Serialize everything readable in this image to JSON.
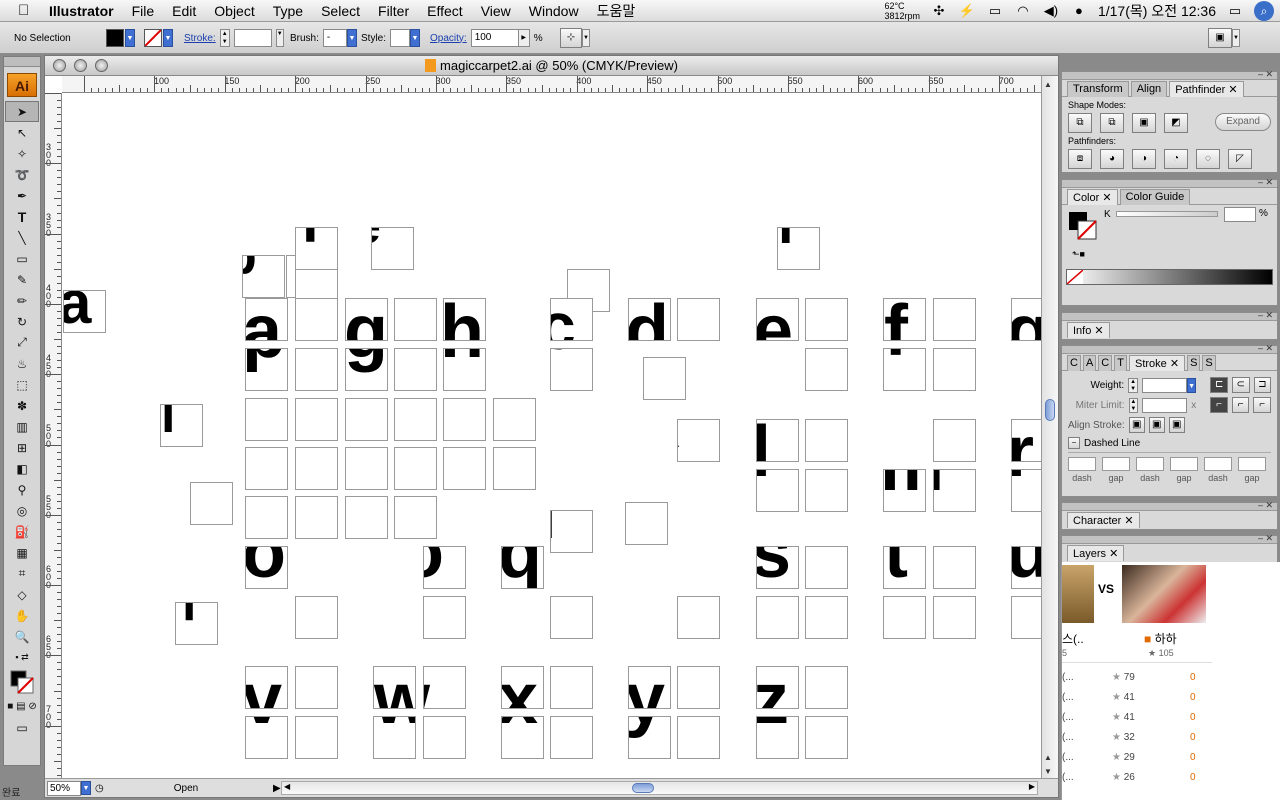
{
  "menubar": {
    "items": [
      "Illustrator",
      "File",
      "Edit",
      "Object",
      "Type",
      "Select",
      "Filter",
      "Effect",
      "View",
      "Window",
      "도움말"
    ],
    "temp": "62°C",
    "rpm": "3812rpm",
    "datetime": "1/17(목) 오전 12:36"
  },
  "controlbar": {
    "selection": "No Selection",
    "stroke_label": "Stroke:",
    "brush_label": "Brush:",
    "brush_value": "-",
    "style_label": "Style:",
    "opacity_label": "Opacity:",
    "opacity_value": "100",
    "percent": "%"
  },
  "tools": {
    "logo": "Ai"
  },
  "document": {
    "title": "magiccarpet2.ai @ 50% (CMYK/Preview)",
    "ruler_h": [
      "100",
      "150",
      "200",
      "250",
      "300",
      "350",
      "400",
      "450",
      "500",
      "550",
      "600",
      "650",
      "700"
    ],
    "ruler_v": [
      "300",
      "350",
      "400",
      "450",
      "500",
      "550",
      "600",
      "650",
      "700"
    ],
    "zoom": "50%",
    "status": "Open"
  },
  "panels": {
    "pathfinder": {
      "tabs": [
        "Transform",
        "Align",
        "Pathfinder"
      ],
      "shape_modes": "Shape Modes:",
      "pathfinders": "Pathfinders:",
      "expand": "Expand"
    },
    "color": {
      "tabs": [
        "Color",
        "Color Guide"
      ],
      "channel": "K",
      "percent": "%"
    },
    "info": {
      "tabs": [
        "Info"
      ]
    },
    "stroke": {
      "tabs": [
        "C",
        "A",
        "C",
        "T",
        "Stroke",
        "S",
        "S"
      ],
      "weight_label": "Weight:",
      "miter_label": "Miter Limit:",
      "miter_unit": "x",
      "align_label": "Align Stroke:",
      "dashed_label": "Dashed Line",
      "dash_labels": [
        "dash",
        "gap",
        "dash",
        "gap",
        "dash",
        "gap"
      ]
    },
    "character": {
      "tabs": [
        "Character"
      ]
    },
    "layers": {
      "tabs": [
        "Layers"
      ]
    }
  },
  "webpeek": {
    "vs": "VS",
    "left_text": "스(..",
    "left_num": "5",
    "badge": "하하",
    "count": "105",
    "rows": [
      {
        "label": "(...",
        "stars": "79",
        "val": "0"
      },
      {
        "label": "(...",
        "stars": "41",
        "val": "0"
      },
      {
        "label": "(...",
        "stars": "41",
        "val": "0"
      },
      {
        "label": "(...",
        "stars": "32",
        "val": "0"
      },
      {
        "label": "(...",
        "stars": "29",
        "val": "0"
      },
      {
        "label": "(...",
        "stars": "26",
        "val": "0"
      }
    ]
  },
  "dock": {
    "left_label": "완료"
  },
  "canvas_letters": [
    "a",
    "b",
    "c",
    "d",
    "e",
    "f",
    "g",
    "h",
    "i",
    "j",
    "k",
    "l",
    "m",
    "n",
    "o",
    "p",
    "q",
    "r",
    "s",
    "t",
    "u",
    "v",
    "w",
    "x",
    "y",
    "z"
  ]
}
